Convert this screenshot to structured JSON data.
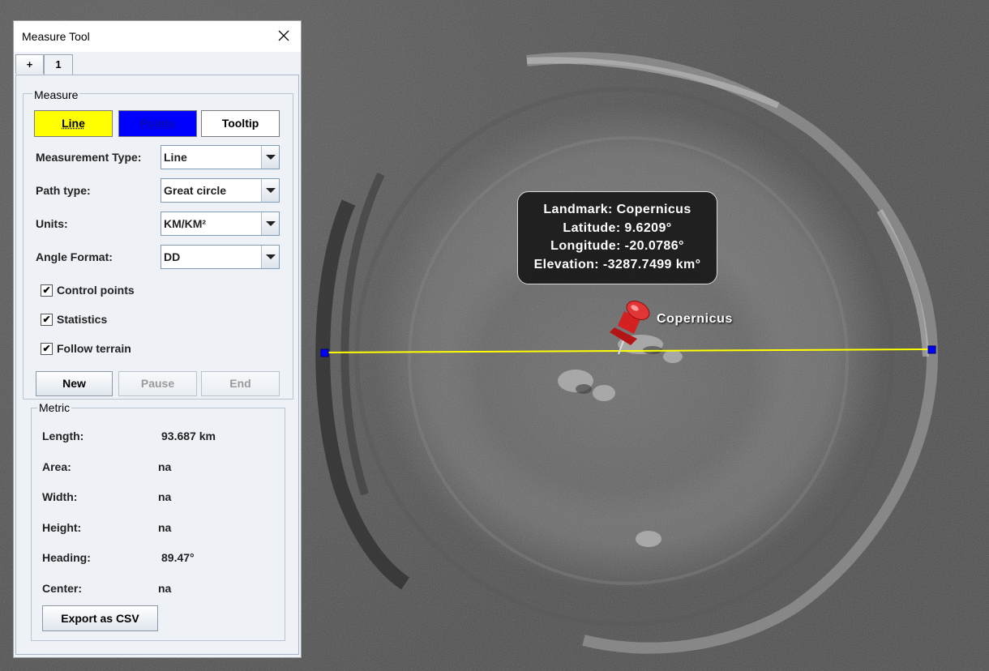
{
  "window": {
    "title": "Measure Tool",
    "tabs": [
      "+",
      "1"
    ]
  },
  "measure": {
    "group_title": "Measure",
    "line_button": "Line",
    "points_button": "Points",
    "tooltip_button": "Tooltip",
    "line_color": "#ffff00",
    "points_color": "#0000ff",
    "fields": {
      "measurement_type": {
        "label": "Measurement Type:",
        "value": "Line"
      },
      "path_type": {
        "label": "Path type:",
        "value": "Great circle"
      },
      "units": {
        "label": "Units:",
        "value": "KM/KM²"
      },
      "angle_format": {
        "label": "Angle Format:",
        "value": "DD"
      }
    },
    "checkboxes": [
      {
        "label": "Control points",
        "checked": true
      },
      {
        "label": "Statistics",
        "checked": true
      },
      {
        "label": "Follow terrain",
        "checked": true
      }
    ],
    "actions": {
      "new": "New",
      "pause": "Pause",
      "end": "End"
    }
  },
  "metric": {
    "group_title": "Metric",
    "rows": [
      {
        "label": "Length:",
        "value": "93.687 km"
      },
      {
        "label": "Area:",
        "value": "na"
      },
      {
        "label": "Width:",
        "value": "na"
      },
      {
        "label": "Height:",
        "value": "na"
      },
      {
        "label": "Heading:",
        "value": "89.47°"
      },
      {
        "label": "Center:",
        "value": "na"
      }
    ],
    "export_button": "Export as CSV"
  },
  "map": {
    "tooltip": [
      "Landmark: Copernicus",
      "Latitude:  9.6209°",
      "Longitude: -20.0786°",
      "Elevation: -3287.7499 km°"
    ],
    "placemark_label": "Copernicus",
    "measure_line_color": "#ffff00",
    "control_point_color": "#0000ff",
    "pin_color": "#d42020"
  }
}
